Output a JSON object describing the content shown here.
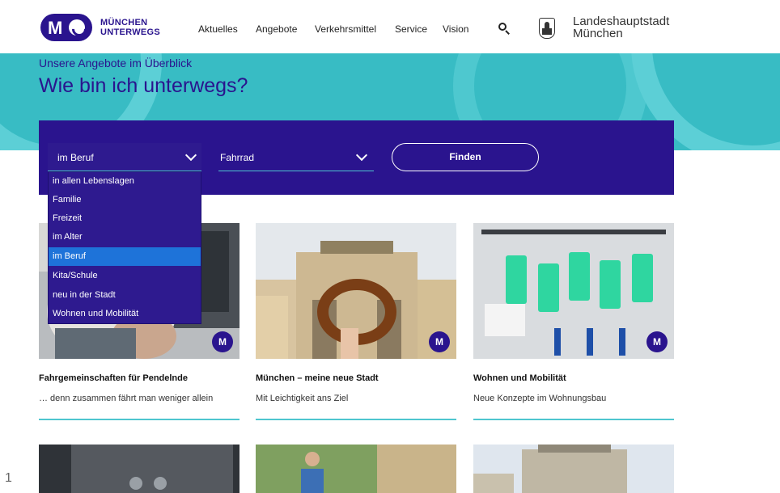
{
  "header": {
    "logo_text_line1": "MÜNCHEN",
    "logo_text_line2": "UNTERWEGS",
    "logo_mark": "M",
    "nav": [
      "Aktuelles",
      "Angebote",
      "Verkehrsmittel",
      "Service",
      "Vision"
    ],
    "city_line1": "Landeshauptstadt",
    "city_line2": "München",
    "icons": {
      "search": "search-icon",
      "crest": "crest-icon"
    }
  },
  "hero": {
    "subtitle": "Unsere Angebote im Überblick",
    "title": "Wie bin ich unterwegs?"
  },
  "finder": {
    "situation_value": "im Beruf",
    "transport_value": "Fahrrad",
    "button_label": "Finden",
    "options": [
      "in allen Lebenslagen",
      "Familie",
      "Freizeit",
      "im Alter",
      "im Beruf",
      "Kita/Schule",
      "neu in der Stadt",
      "Wohnen und Mobilität"
    ],
    "selected_option": "im Beruf"
  },
  "cards": [
    {
      "title": "Fahrgemeinschaften für Pendelnde",
      "desc": "… denn zusammen fährt man weniger allein",
      "badge": "M"
    },
    {
      "title": "München – meine neue Stadt",
      "desc": "Mit Leichtigkeit ans Ziel",
      "badge": "M"
    },
    {
      "title": "Wohnen und Mobilität",
      "desc": "Neue Konzepte im Wohnungsbau",
      "badge": "M"
    }
  ],
  "page_number": "1",
  "colors": {
    "brand": "#2a148e",
    "teal": "#38bcc4",
    "accent_line": "#4fc6cf",
    "selected": "#1e73d9"
  }
}
